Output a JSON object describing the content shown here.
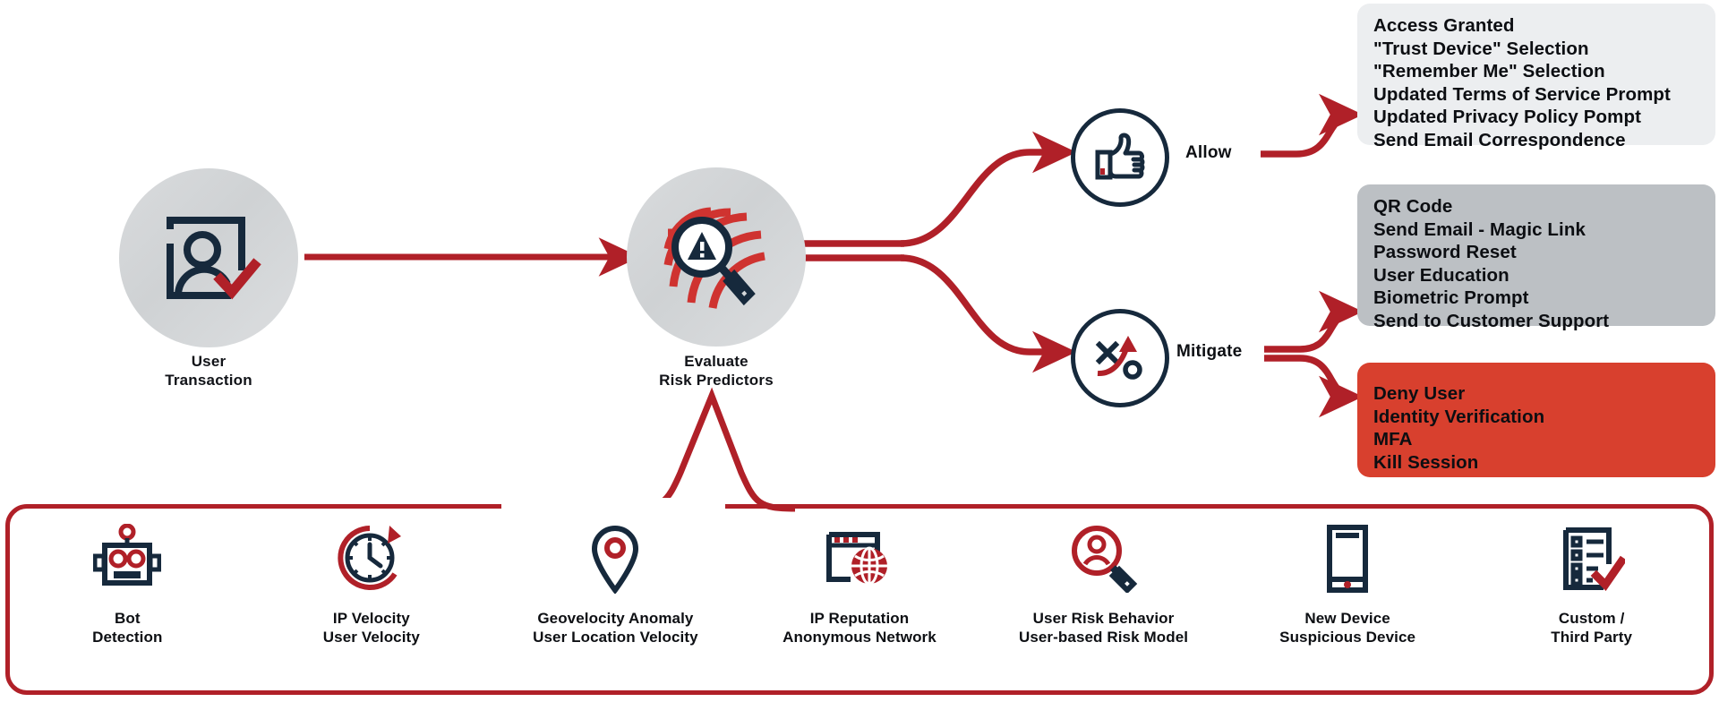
{
  "flow": {
    "start_node": {
      "label_line1": "User",
      "label_line2": "Transaction",
      "icon": "user-id-check-icon"
    },
    "evaluate_node": {
      "label_line1": "Evaluate",
      "label_line2": "Risk Predictors",
      "icon": "fingerprint-warning-magnifier-icon"
    },
    "outcomes": [
      {
        "id": "allow",
        "label": "Allow",
        "icon": "thumbs-up-icon"
      },
      {
        "id": "mitigate",
        "label": "Mitigate",
        "icon": "strategy-xo-arrow-icon"
      }
    ]
  },
  "action_boxes": [
    {
      "id": "allow-actions",
      "background": "#eceef0",
      "items": [
        "Access Granted",
        "\"Trust Device\" Selection",
        "\"Remember Me\" Selection",
        "Updated Terms of Service Prompt",
        "Updated Privacy Policy Pompt",
        "Send Email Correspondence"
      ]
    },
    {
      "id": "mitigate-actions",
      "background": "#bcc0c4",
      "items": [
        "QR Code",
        "Send Email - Magic Link",
        "Password Reset",
        "User Education",
        "Biometric Prompt",
        "Send to Customer Support"
      ]
    },
    {
      "id": "deny-actions",
      "background": "#d8402e",
      "items": [
        "Deny User",
        "Identity Verification",
        "MFA",
        "Kill Session"
      ]
    }
  ],
  "predictors": [
    {
      "icon": "robot-icon",
      "line1": "Bot",
      "line2": "Detection"
    },
    {
      "icon": "clock-refresh-icon",
      "line1": "IP Velocity",
      "line2": "User Velocity"
    },
    {
      "icon": "map-pin-icon",
      "line1": "Geovelocity Anomaly",
      "line2": "User Location Velocity"
    },
    {
      "icon": "browser-globe-icon",
      "line1": "IP Reputation",
      "line2": "Anonymous Network"
    },
    {
      "icon": "user-magnifier-icon",
      "line1": "User Risk Behavior",
      "line2": "User-based Risk Model"
    },
    {
      "icon": "mobile-device-icon",
      "line1": "New Device",
      "line2": "Suspicious Device"
    },
    {
      "icon": "checklist-check-icon",
      "line1": "Custom /",
      "line2": "Third Party"
    }
  ],
  "colors": {
    "accent_red": "#b02028",
    "dark_navy": "#16293c",
    "deny_red": "#d8402e",
    "mitigate_gray": "#bcc0c4",
    "allow_gray": "#eceef0",
    "node_gray": "#d4d7d9"
  }
}
